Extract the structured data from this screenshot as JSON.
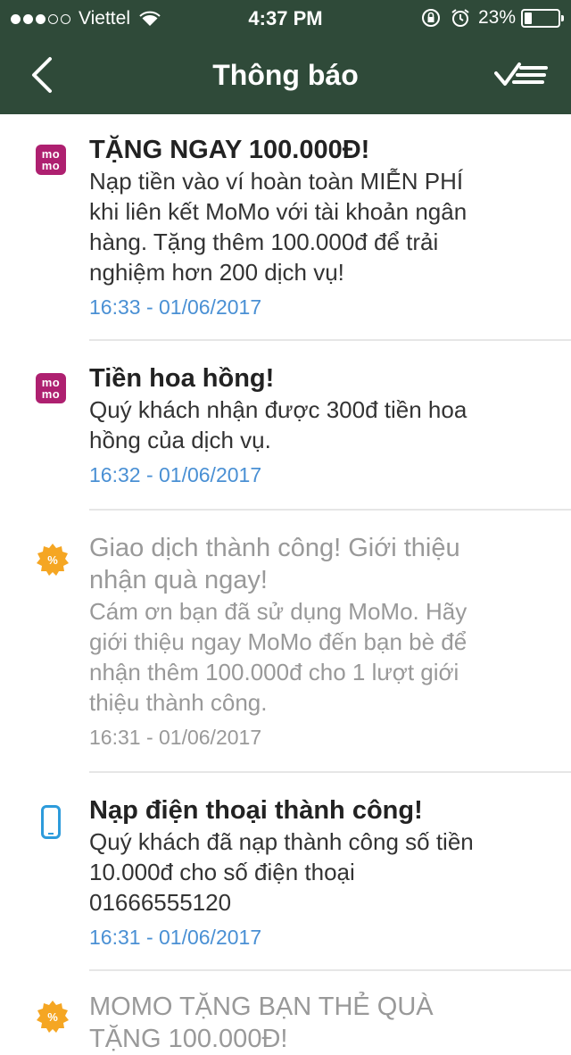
{
  "status_bar": {
    "carrier": "Viettel",
    "time": "4:37 PM",
    "battery": "23%",
    "signal_bars_filled": 3,
    "signal_bars_total": 5
  },
  "header": {
    "title": "Thông báo",
    "back_icon": "chevron-left-icon",
    "action_icon": "mark-all-read-icon",
    "background": "#2f4a39"
  },
  "notifications": [
    {
      "icon": "momo-logo",
      "title": "TẶNG NGAY 100.000Đ!",
      "body_lines": [
        "Nạp tiền vào ví hoàn toàn MIỄN PHÍ",
        "khi liên kết MoMo với tài khoản ngân",
        "hàng. Tặng thêm 100.000đ để trải",
        "nghiệm hơn 200 dịch vụ!"
      ],
      "timestamp": "16:33 - 01/06/2017",
      "read": false
    },
    {
      "icon": "momo-logo",
      "title": "Tiền hoa hồng!",
      "body_lines": [
        "Quý khách nhận được 300đ tiền hoa",
        "hồng của dịch vụ."
      ],
      "timestamp": "16:32 - 01/06/2017",
      "read": false
    },
    {
      "icon": "promo-badge-icon",
      "title_lines": [
        "Giao dịch thành công! Giới thiệu",
        "nhận quà ngay!"
      ],
      "body_lines": [
        "Cám ơn bạn đã sử dụng MoMo. Hãy",
        "giới thiệu ngay MoMo đến bạn bè để",
        "nhận thêm 100.000đ cho 1 lượt giới",
        "thiệu thành công."
      ],
      "timestamp": "16:31 - 01/06/2017",
      "read": true
    },
    {
      "icon": "phone-icon",
      "title": "Nạp điện thoại thành công!",
      "body_lines": [
        "Quý khách đã nạp thành công số tiền",
        "10.000đ cho số điện thoại",
        "01666555120"
      ],
      "timestamp": "16:31 - 01/06/2017",
      "read": false
    },
    {
      "icon": "promo-badge-icon",
      "title_lines": [
        "MOMO TẶNG BẠN THẺ QUÀ",
        "TẶNG 100.000Đ!"
      ],
      "read": true
    }
  ],
  "momo_logo_text": [
    "mo",
    "mo"
  ],
  "colors": {
    "momo": "#ae2070",
    "promo": "#f5a623",
    "phone": "#2d9bdb",
    "timestamp": "#4a90d4"
  }
}
